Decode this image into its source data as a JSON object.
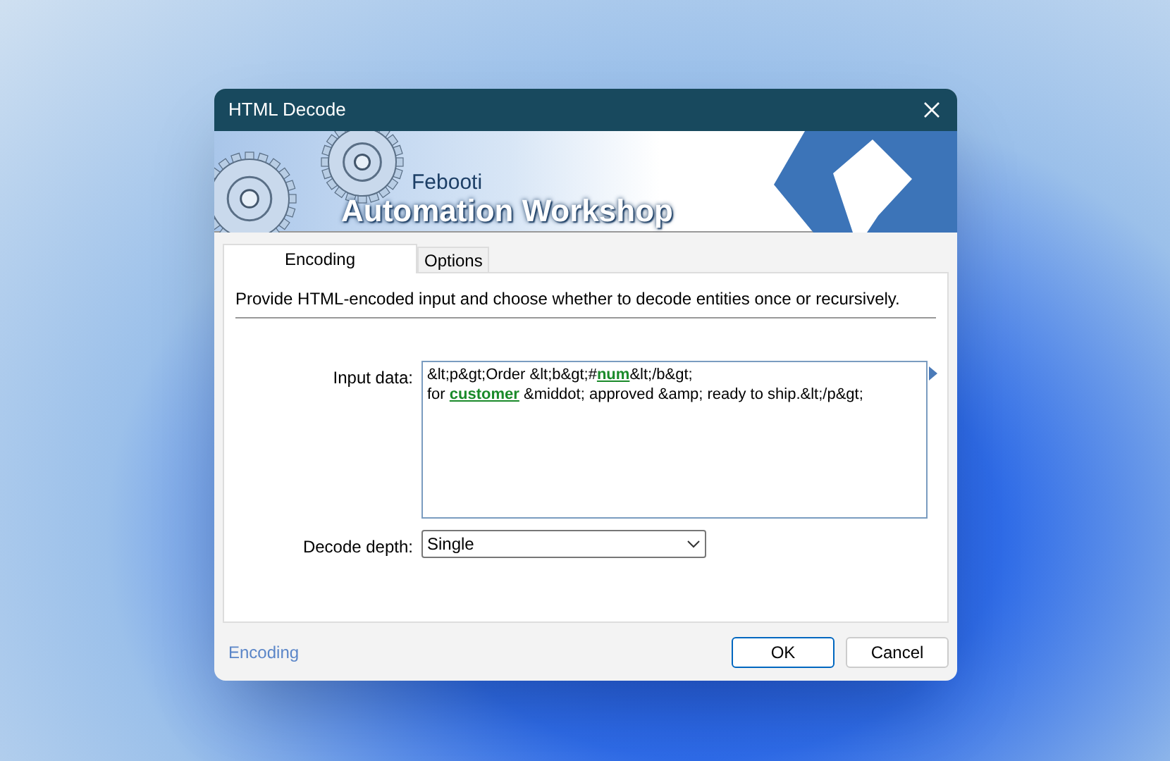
{
  "window": {
    "title": "HTML Decode"
  },
  "banner": {
    "brand": "Febooti",
    "product": "Automation Workshop"
  },
  "tabs": [
    {
      "label": "Encoding",
      "selected": true
    },
    {
      "label": "Options",
      "selected": false
    }
  ],
  "description": "Provide HTML-encoded input and choose whether to decode entities once or recursively.",
  "fields": [
    {
      "kind": "textarea",
      "label": "Input data:",
      "lines": [
        "&lt;p&gt;Order &lt;b&gt;#**num**&lt;/b&gt;",
        "for **customer** &middot; approved &amp; ready to ship.&lt;/p&gt;"
      ]
    },
    {
      "kind": "select",
      "label": "Decode depth:",
      "value": "Single"
    }
  ],
  "status_bar": {
    "link": "Encoding",
    "buttons": [
      {
        "label": "OK",
        "default": true
      },
      {
        "label": "Cancel",
        "default": false
      }
    ]
  }
}
